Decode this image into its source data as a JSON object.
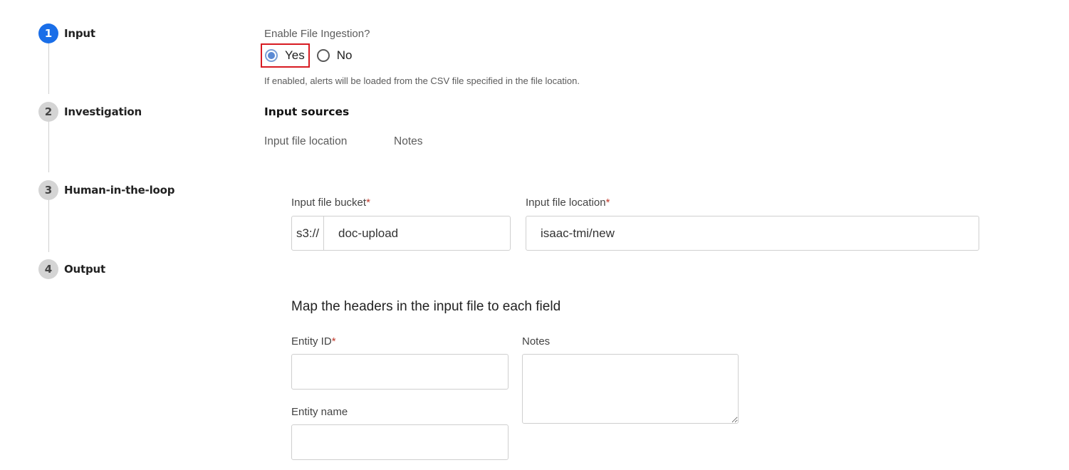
{
  "stepper": {
    "steps": [
      {
        "number": "1",
        "label": "Input"
      },
      {
        "number": "2",
        "label": "Investigation"
      },
      {
        "number": "3",
        "label": "Human-in-the-loop"
      },
      {
        "number": "4",
        "label": "Output"
      }
    ],
    "active_step": 1,
    "active_color": "#1a6ee8"
  },
  "ingestion": {
    "question": "Enable File Ingestion?",
    "options": {
      "yes": "Yes",
      "no": "No"
    },
    "selected": "Yes",
    "help_text": "If enabled, alerts will be loaded from the CSV file specified in the file location.",
    "highlight_color": "#d81b22"
  },
  "input_sources": {
    "title": "Input sources",
    "tabs": [
      "Input file location",
      "Notes"
    ]
  },
  "file": {
    "bucket_label": "Input file bucket",
    "bucket_prefix": "s3://",
    "bucket_value": "doc-upload",
    "location_label": "Input file location",
    "location_value": "isaac-tmi/new",
    "required_marker": "*"
  },
  "mapping": {
    "title": "Map the headers in the input file to each field",
    "entity_id_label": "Entity ID",
    "entity_id_value": "",
    "notes_label": "Notes",
    "notes_value": "",
    "entity_name_label": "Entity name",
    "entity_name_value": ""
  }
}
